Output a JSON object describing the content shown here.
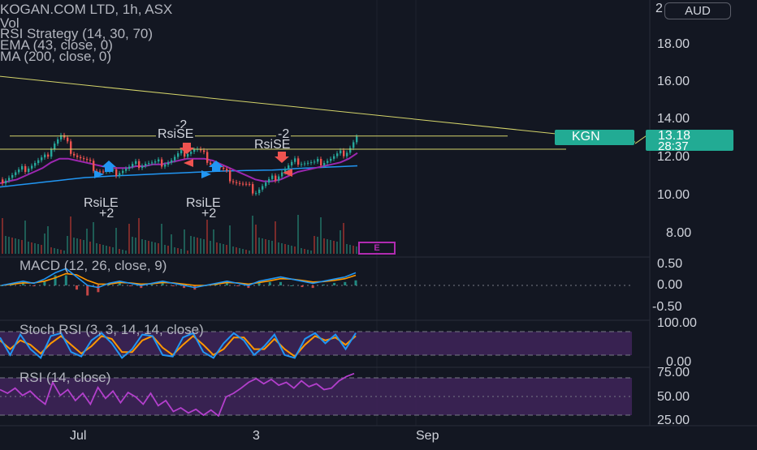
{
  "header": {
    "symbol_line": "KOGAN.COM LTD, 1h, ASX",
    "vol_label": "Vol",
    "strategy_label": "RSI Strategy (14, 30, 70)",
    "ema_label": "EMA (43, close, 0)",
    "ma_label": "MA (200, close, 0)",
    "currency": "AUD"
  },
  "price_axis": {
    "labels": [
      "18.00",
      "16.00",
      "14.00",
      "12.00",
      "10.00",
      "8.00"
    ],
    "top_partial": "2"
  },
  "price_tag": {
    "symbol": "KGN",
    "price": "13.18",
    "countdown": "28:37"
  },
  "time_axis": [
    "Jul",
    "3",
    "Sep"
  ],
  "signals": {
    "short": [
      {
        "label": "RsiSE",
        "qty": "-2"
      },
      {
        "label": "RsiSE",
        "qty": "-2"
      }
    ],
    "long": [
      {
        "label": "RsiLE",
        "qty": "+2"
      },
      {
        "label": "RsiLE",
        "qty": "+2"
      }
    ]
  },
  "event_badge": "E",
  "panes": {
    "macd": {
      "title": "MACD (12, 26, close, 9)",
      "axis": [
        "0.50",
        "0.00",
        "-0.50"
      ]
    },
    "stoch": {
      "title": "Stoch RSI (3, 3, 14, 14, close)",
      "axis": [
        "100.00",
        "0.00"
      ]
    },
    "rsi": {
      "title": "RSI (14, close)",
      "axis": [
        "75.00",
        "50.00",
        "25.00"
      ]
    }
  },
  "colors": {
    "background": "#131722",
    "candle_up": "#26a69a",
    "candle_down": "#ef5350",
    "ema": "#2196f3",
    "ma": "#9c27b0",
    "trendline": "#d4d46a",
    "rsi_line": "#b33fcc",
    "stoch_k": "#2196f3",
    "stoch_d": "#ff9800",
    "band": "#3d2357"
  },
  "chart_data": [
    {
      "type": "candlestick",
      "title": "KOGAN.COM LTD, 1h, ASX",
      "currency": "AUD",
      "ylim": [
        7,
        20
      ],
      "last_price": 13.18,
      "x_ticks": [
        "Jul",
        "3",
        "Sep"
      ],
      "close_path": [
        11.0,
        11.2,
        11.4,
        11.7,
        11.9,
        12.1,
        12.9,
        13.3,
        12.6,
        12.2,
        11.9,
        11.6,
        11.4,
        11.3,
        11.5,
        11.6,
        11.8,
        11.9,
        11.8,
        11.9,
        12.0,
        12.3,
        12.5,
        12.6,
        12.2,
        11.8,
        11.5,
        11.1,
        10.8,
        10.6,
        10.4,
        10.7,
        11.0,
        11.4,
        11.7,
        12.0,
        11.9,
        11.8,
        12.0,
        12.1,
        12.3,
        12.6,
        13.2
      ],
      "series": [
        {
          "name": "EMA (43, close, 0)",
          "values": [
            10.8,
            10.9,
            11.0,
            11.2,
            11.4,
            11.6,
            11.9,
            12.1,
            12.1,
            12.0,
            11.9,
            11.8,
            11.7,
            11.6,
            11.6,
            11.6,
            11.7,
            11.7,
            11.8,
            11.8,
            11.9,
            12.0,
            12.1,
            12.1,
            12.1,
            12.0,
            11.8,
            11.6,
            11.4,
            11.2,
            11.0,
            10.9,
            10.9,
            11.0,
            11.2,
            11.4,
            11.5,
            11.6,
            11.7,
            11.8,
            11.9,
            12.1,
            12.4
          ]
        },
        {
          "name": "MA (200, close, 0)",
          "values": [
            10.6,
            10.65,
            10.7,
            10.75,
            10.8,
            10.85,
            10.9,
            10.95,
            11.0,
            11.05,
            11.1,
            11.12,
            11.15,
            11.18,
            11.2,
            11.22,
            11.24,
            11.26,
            11.28,
            11.3,
            11.32,
            11.34,
            11.36,
            11.38,
            11.4,
            11.42,
            11.44,
            11.45,
            11.46,
            11.47,
            11.48,
            11.49,
            11.5,
            11.52,
            11.55,
            11.58,
            11.6,
            11.62,
            11.64,
            11.66,
            11.68,
            11.7,
            11.72
          ]
        }
      ]
    },
    {
      "type": "line",
      "title": "MACD (12, 26, close, 9)",
      "ylim": [
        -0.6,
        0.6
      ],
      "x_ticks": [
        "Jul",
        "3",
        "Sep"
      ],
      "series": [
        {
          "name": "MACD",
          "values": [
            0.0,
            0.05,
            0.1,
            0.05,
            0.15,
            0.3,
            0.4,
            0.2,
            0.0,
            -0.05,
            0.05,
            0.1,
            0.05,
            0.0,
            0.05,
            0.1,
            0.05,
            0.0,
            -0.05,
            0.0,
            0.05,
            0.1,
            0.05,
            0.0,
            0.1,
            0.15,
            0.2,
            0.15,
            0.1,
            0.05,
            0.1,
            0.15,
            0.2,
            0.3
          ]
        },
        {
          "name": "Signal",
          "values": [
            0.0,
            0.03,
            0.06,
            0.06,
            0.1,
            0.18,
            0.28,
            0.25,
            0.12,
            0.03,
            0.03,
            0.07,
            0.06,
            0.03,
            0.04,
            0.07,
            0.06,
            0.03,
            0.0,
            0.0,
            0.03,
            0.07,
            0.06,
            0.03,
            0.07,
            0.11,
            0.16,
            0.15,
            0.12,
            0.08,
            0.09,
            0.12,
            0.16,
            0.24
          ]
        }
      ]
    },
    {
      "type": "line",
      "title": "Stoch RSI (3, 3, 14, 14, close)",
      "ylim": [
        0,
        100
      ],
      "x_ticks": [
        "Jul",
        "3",
        "Sep"
      ],
      "series": [
        {
          "name": "K",
          "values": [
            80,
            20,
            90,
            40,
            10,
            85,
            95,
            30,
            15,
            70,
            95,
            60,
            10,
            40,
            90,
            85,
            20,
            15,
            80,
            95,
            30,
            10,
            60,
            95,
            70,
            20,
            50,
            90,
            20,
            10,
            75,
            95,
            60,
            90,
            40,
            95
          ]
        },
        {
          "name": "D",
          "values": [
            70,
            40,
            70,
            55,
            25,
            60,
            85,
            55,
            25,
            50,
            85,
            75,
            30,
            30,
            70,
            85,
            45,
            20,
            55,
            85,
            55,
            20,
            40,
            80,
            80,
            40,
            40,
            75,
            40,
            15,
            55,
            85,
            70,
            80,
            55,
            85
          ]
        }
      ]
    },
    {
      "type": "line",
      "title": "RSI (14, close)",
      "ylim": [
        15,
        85
      ],
      "x_ticks": [
        "Jul",
        "3",
        "Sep"
      ],
      "series": [
        {
          "name": "RSI",
          "values": [
            60,
            55,
            62,
            52,
            58,
            48,
            40,
            70,
            52,
            60,
            45,
            55,
            40,
            63,
            48,
            58,
            42,
            56,
            50,
            40,
            55,
            38,
            45,
            30,
            35,
            28,
            33,
            25,
            32,
            24,
            50,
            55,
            62,
            70,
            75,
            68,
            74,
            66,
            70,
            62,
            72,
            64,
            68,
            60,
            62,
            72,
            78,
            82
          ]
        }
      ]
    }
  ]
}
